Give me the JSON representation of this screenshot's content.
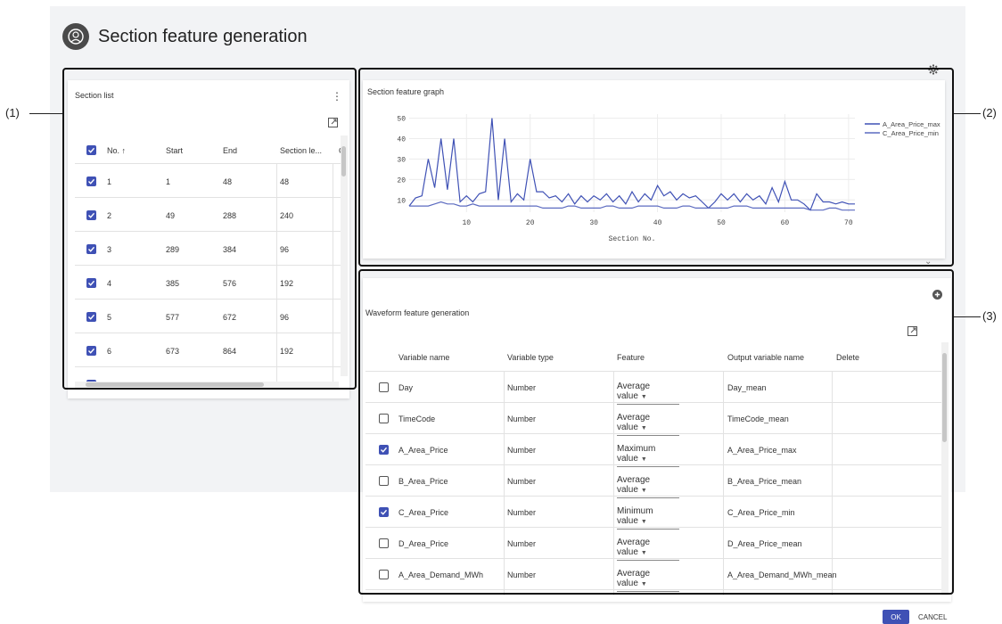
{
  "page": {
    "title": "Section feature generation"
  },
  "callouts": {
    "c1": "(1)",
    "c2": "(2)",
    "c3": "(3)"
  },
  "section_list": {
    "title": "Section list",
    "columns": [
      "No. ↑",
      "Start",
      "End",
      "Section le..."
    ],
    "rows": [
      {
        "no": "1",
        "start": "1",
        "end": "48",
        "len": "48"
      },
      {
        "no": "2",
        "start": "49",
        "end": "288",
        "len": "240"
      },
      {
        "no": "3",
        "start": "289",
        "end": "384",
        "len": "96"
      },
      {
        "no": "4",
        "start": "385",
        "end": "576",
        "len": "192"
      },
      {
        "no": "5",
        "start": "577",
        "end": "672",
        "len": "96"
      },
      {
        "no": "6",
        "start": "673",
        "end": "864",
        "len": "192"
      }
    ]
  },
  "graph": {
    "title": "Section feature graph"
  },
  "chart_data": {
    "type": "line",
    "title": "",
    "xlabel": "Section No.",
    "ylabel": "",
    "xlim": [
      1,
      71
    ],
    "ylim": [
      4,
      52
    ],
    "x_ticks": [
      10,
      20,
      30,
      40,
      50,
      60,
      70
    ],
    "y_ticks": [
      10,
      20,
      30,
      40,
      50
    ],
    "grid": true,
    "legend": "top-right",
    "series": [
      {
        "name": "A_Area_Price_max",
        "color": "#3f51b5",
        "x": [
          1,
          2,
          3,
          4,
          5,
          6,
          7,
          8,
          9,
          10,
          11,
          12,
          13,
          14,
          15,
          16,
          17,
          18,
          19,
          20,
          21,
          22,
          23,
          24,
          25,
          26,
          27,
          28,
          29,
          30,
          31,
          32,
          33,
          34,
          35,
          36,
          37,
          38,
          39,
          40,
          41,
          42,
          43,
          44,
          45,
          46,
          47,
          48,
          49,
          50,
          51,
          52,
          53,
          54,
          55,
          56,
          57,
          58,
          59,
          60,
          61,
          62,
          63,
          64,
          65,
          66,
          67,
          68,
          69,
          70,
          71
        ],
        "values": [
          7,
          11,
          12,
          30,
          16,
          40,
          15,
          40,
          9,
          12,
          9,
          13,
          14,
          50,
          10,
          40,
          9,
          13,
          10,
          30,
          14,
          14,
          11,
          12,
          9,
          13,
          8,
          12,
          9,
          12,
          10,
          13,
          9,
          12,
          8,
          14,
          9,
          13,
          10,
          17,
          12,
          14,
          10,
          13,
          11,
          12,
          9,
          6,
          9,
          13,
          10,
          13,
          9,
          13,
          10,
          12,
          8,
          16,
          9,
          19,
          10,
          10,
          8,
          5,
          13,
          9,
          9,
          8,
          9,
          8,
          8
        ]
      },
      {
        "name": "C_Area_Price_min",
        "color": "#5c6bc0",
        "x": [
          1,
          2,
          3,
          4,
          5,
          6,
          7,
          8,
          9,
          10,
          11,
          12,
          13,
          14,
          15,
          16,
          17,
          18,
          19,
          20,
          21,
          22,
          23,
          24,
          25,
          26,
          27,
          28,
          29,
          30,
          31,
          32,
          33,
          34,
          35,
          36,
          37,
          38,
          39,
          40,
          41,
          42,
          43,
          44,
          45,
          46,
          47,
          48,
          49,
          50,
          51,
          52,
          53,
          54,
          55,
          56,
          57,
          58,
          59,
          60,
          61,
          62,
          63,
          64,
          65,
          66,
          67,
          68,
          69,
          70,
          71
        ],
        "values": [
          7,
          7,
          7,
          7,
          8,
          9,
          8,
          8,
          7,
          7,
          8,
          7,
          7,
          7,
          7,
          7,
          7,
          7,
          7,
          7,
          7,
          6,
          6,
          6,
          6,
          7,
          7,
          6,
          6,
          6,
          6,
          7,
          7,
          6,
          6,
          6,
          7,
          7,
          7,
          7,
          6,
          6,
          6,
          7,
          7,
          6,
          6,
          6,
          6,
          6,
          6,
          7,
          7,
          7,
          6,
          6,
          6,
          6,
          6,
          6,
          6,
          6,
          6,
          5,
          5,
          5,
          6,
          6,
          5,
          5,
          5
        ]
      }
    ]
  },
  "waveform": {
    "title": "Waveform feature generation",
    "columns": [
      "Variable name",
      "Variable type",
      "Feature",
      "Output variable name",
      "Delete"
    ],
    "rows": [
      {
        "checked": false,
        "name": "Day",
        "type": "Number",
        "feature": "Average value",
        "output": "Day_mean"
      },
      {
        "checked": false,
        "name": "TimeCode",
        "type": "Number",
        "feature": "Average value",
        "output": "TimeCode_mean"
      },
      {
        "checked": true,
        "name": "A_Area_Price",
        "type": "Number",
        "feature": "Maximum value",
        "output": "A_Area_Price_max"
      },
      {
        "checked": false,
        "name": "B_Area_Price",
        "type": "Number",
        "feature": "Average value",
        "output": "B_Area_Price_mean"
      },
      {
        "checked": true,
        "name": "C_Area_Price",
        "type": "Number",
        "feature": "Minimum value",
        "output": "C_Area_Price_min"
      },
      {
        "checked": false,
        "name": "D_Area_Price",
        "type": "Number",
        "feature": "Average value",
        "output": "D_Area_Price_mean"
      },
      {
        "checked": false,
        "name": "A_Area_Demand_MWh",
        "type": "Number",
        "feature": "Average value",
        "output": "A_Area_Demand_MWh_mean"
      }
    ]
  },
  "footer": {
    "ok": "OK",
    "cancel": "CANCEL"
  }
}
